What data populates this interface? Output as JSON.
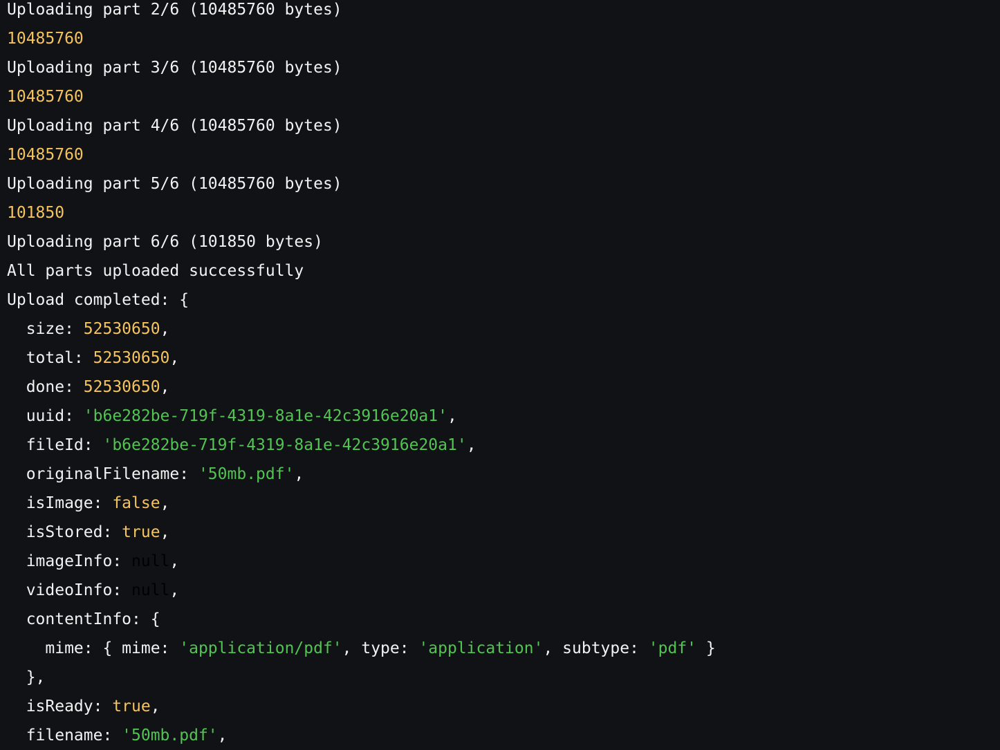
{
  "colors": {
    "background": "#111216",
    "text": "#f2f2f2",
    "number": "#f5c45e",
    "string": "#52c452",
    "null": "#000000"
  },
  "terminal": {
    "lines": [
      [
        [
          "plain",
          "Uploading part 2/6 (10485760 bytes)"
        ]
      ],
      [
        [
          "num",
          "10485760"
        ]
      ],
      [
        [
          "plain",
          "Uploading part 3/6 (10485760 bytes)"
        ]
      ],
      [
        [
          "num",
          "10485760"
        ]
      ],
      [
        [
          "plain",
          "Uploading part 4/6 (10485760 bytes)"
        ]
      ],
      [
        [
          "num",
          "10485760"
        ]
      ],
      [
        [
          "plain",
          "Uploading part 5/6 (10485760 bytes)"
        ]
      ],
      [
        [
          "num",
          "101850"
        ]
      ],
      [
        [
          "plain",
          "Uploading part 6/6 (101850 bytes)"
        ]
      ],
      [
        [
          "plain",
          "All parts uploaded successfully"
        ]
      ],
      [
        [
          "plain",
          "Upload completed: {"
        ]
      ],
      [
        [
          "plain",
          "  size: "
        ],
        [
          "num",
          "52530650"
        ],
        [
          "plain",
          ","
        ]
      ],
      [
        [
          "plain",
          "  total: "
        ],
        [
          "num",
          "52530650"
        ],
        [
          "plain",
          ","
        ]
      ],
      [
        [
          "plain",
          "  done: "
        ],
        [
          "num",
          "52530650"
        ],
        [
          "plain",
          ","
        ]
      ],
      [
        [
          "plain",
          "  uuid: "
        ],
        [
          "str",
          "'b6e282be-719f-4319-8a1e-42c3916e20a1'"
        ],
        [
          "plain",
          ","
        ]
      ],
      [
        [
          "plain",
          "  fileId: "
        ],
        [
          "str",
          "'b6e282be-719f-4319-8a1e-42c3916e20a1'"
        ],
        [
          "plain",
          ","
        ]
      ],
      [
        [
          "plain",
          "  originalFilename: "
        ],
        [
          "str",
          "'50mb.pdf'"
        ],
        [
          "plain",
          ","
        ]
      ],
      [
        [
          "plain",
          "  isImage: "
        ],
        [
          "kw",
          "false"
        ],
        [
          "plain",
          ","
        ]
      ],
      [
        [
          "plain",
          "  isStored: "
        ],
        [
          "kw",
          "true"
        ],
        [
          "plain",
          ","
        ]
      ],
      [
        [
          "plain",
          "  imageInfo: "
        ],
        [
          "nul",
          "null"
        ],
        [
          "plain",
          ","
        ]
      ],
      [
        [
          "plain",
          "  videoInfo: "
        ],
        [
          "nul",
          "null"
        ],
        [
          "plain",
          ","
        ]
      ],
      [
        [
          "plain",
          "  contentInfo: {"
        ]
      ],
      [
        [
          "plain",
          "    mime: { mime: "
        ],
        [
          "str",
          "'application/pdf'"
        ],
        [
          "plain",
          ", type: "
        ],
        [
          "str",
          "'application'"
        ],
        [
          "plain",
          ", subtype: "
        ],
        [
          "str",
          "'pdf'"
        ],
        [
          "plain",
          " }"
        ]
      ],
      [
        [
          "plain",
          "  },"
        ]
      ],
      [
        [
          "plain",
          "  isReady: "
        ],
        [
          "kw",
          "true"
        ],
        [
          "plain",
          ","
        ]
      ],
      [
        [
          "plain",
          "  filename: "
        ],
        [
          "str",
          "'50mb.pdf'"
        ],
        [
          "plain",
          ","
        ]
      ]
    ]
  }
}
